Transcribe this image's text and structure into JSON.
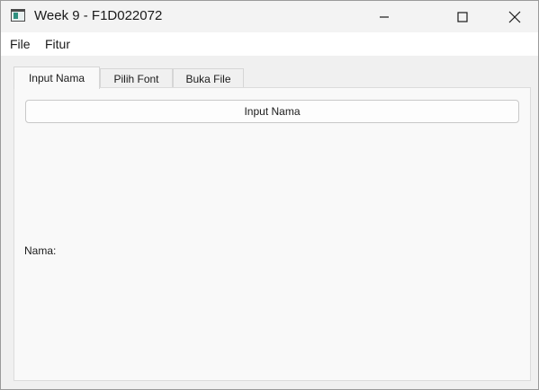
{
  "window": {
    "title": "Week 9 - F1D022072",
    "app_icon": "window-app-icon",
    "controls": {
      "minimize_icon": "minimize-icon",
      "maximize_icon": "maximize-icon",
      "close_icon": "close-icon"
    }
  },
  "menubar": {
    "items": [
      {
        "label": "File"
      },
      {
        "label": "Fitur"
      }
    ]
  },
  "tabs": [
    {
      "label": "Input Nama",
      "active": true
    },
    {
      "label": "Pilih Font",
      "active": false
    },
    {
      "label": "Buka File",
      "active": false
    }
  ],
  "panel": {
    "input_button_label": "Input Nama",
    "name_label": "Nama:"
  }
}
